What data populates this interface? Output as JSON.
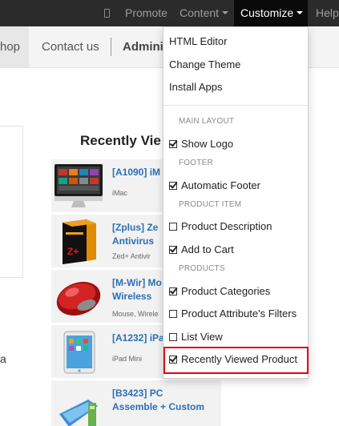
{
  "topbar": {
    "promote": "Promote",
    "content": "Content",
    "customize": "Customize",
    "help": "Help"
  },
  "nav": {
    "shop": "hop",
    "contact": "Contact us",
    "admin": "Admini"
  },
  "main": {
    "left_glyph": "a",
    "recently_viewed_title": "Recently Vie",
    "products": [
      {
        "name_lines": [
          "[A1090] iM"
        ],
        "sub": "iMac",
        "icon": "imac-thumb"
      },
      {
        "name_lines": [
          "[Zplus] Ze",
          "Antivirus"
        ],
        "sub": "Zed+ Antivir",
        "icon": "antivirus-box-thumb"
      },
      {
        "name_lines": [
          "[M-Wir] Mo",
          "Wireless"
        ],
        "sub": "Mouse, Wirele",
        "icon": "mouse-thumb"
      },
      {
        "name_lines": [
          "[A1232] iPa"
        ],
        "sub": "iPad Mini",
        "icon": "ipad-thumb"
      },
      {
        "name_lines": [
          "[B3423] PC",
          "Assemble + Custom"
        ],
        "sub": "",
        "icon": "pc-thumb"
      }
    ]
  },
  "customize_menu": {
    "items": [
      "HTML Editor",
      "Change Theme",
      "Install Apps"
    ],
    "headers": {
      "main_layout": "MAIN LAYOUT",
      "footer": "FOOTER",
      "product_item": "PRODUCT ITEM",
      "products": "PRODUCTS"
    },
    "options": [
      {
        "label": "Show Logo",
        "checked": true
      },
      {
        "label": "Automatic Footer",
        "checked": true
      },
      {
        "label": "Product Description",
        "checked": false
      },
      {
        "label": "Add to Cart",
        "checked": true
      },
      {
        "label": "Product Categories",
        "checked": true
      },
      {
        "label": "Product Attribute's Filters",
        "checked": false
      },
      {
        "label": "List View",
        "checked": false
      },
      {
        "label": "Recently Viewed Product",
        "checked": true
      }
    ]
  },
  "colors": {
    "highlight": "#e3000f",
    "link": "#2a6fb7",
    "topbar": "#2b2b2b"
  }
}
